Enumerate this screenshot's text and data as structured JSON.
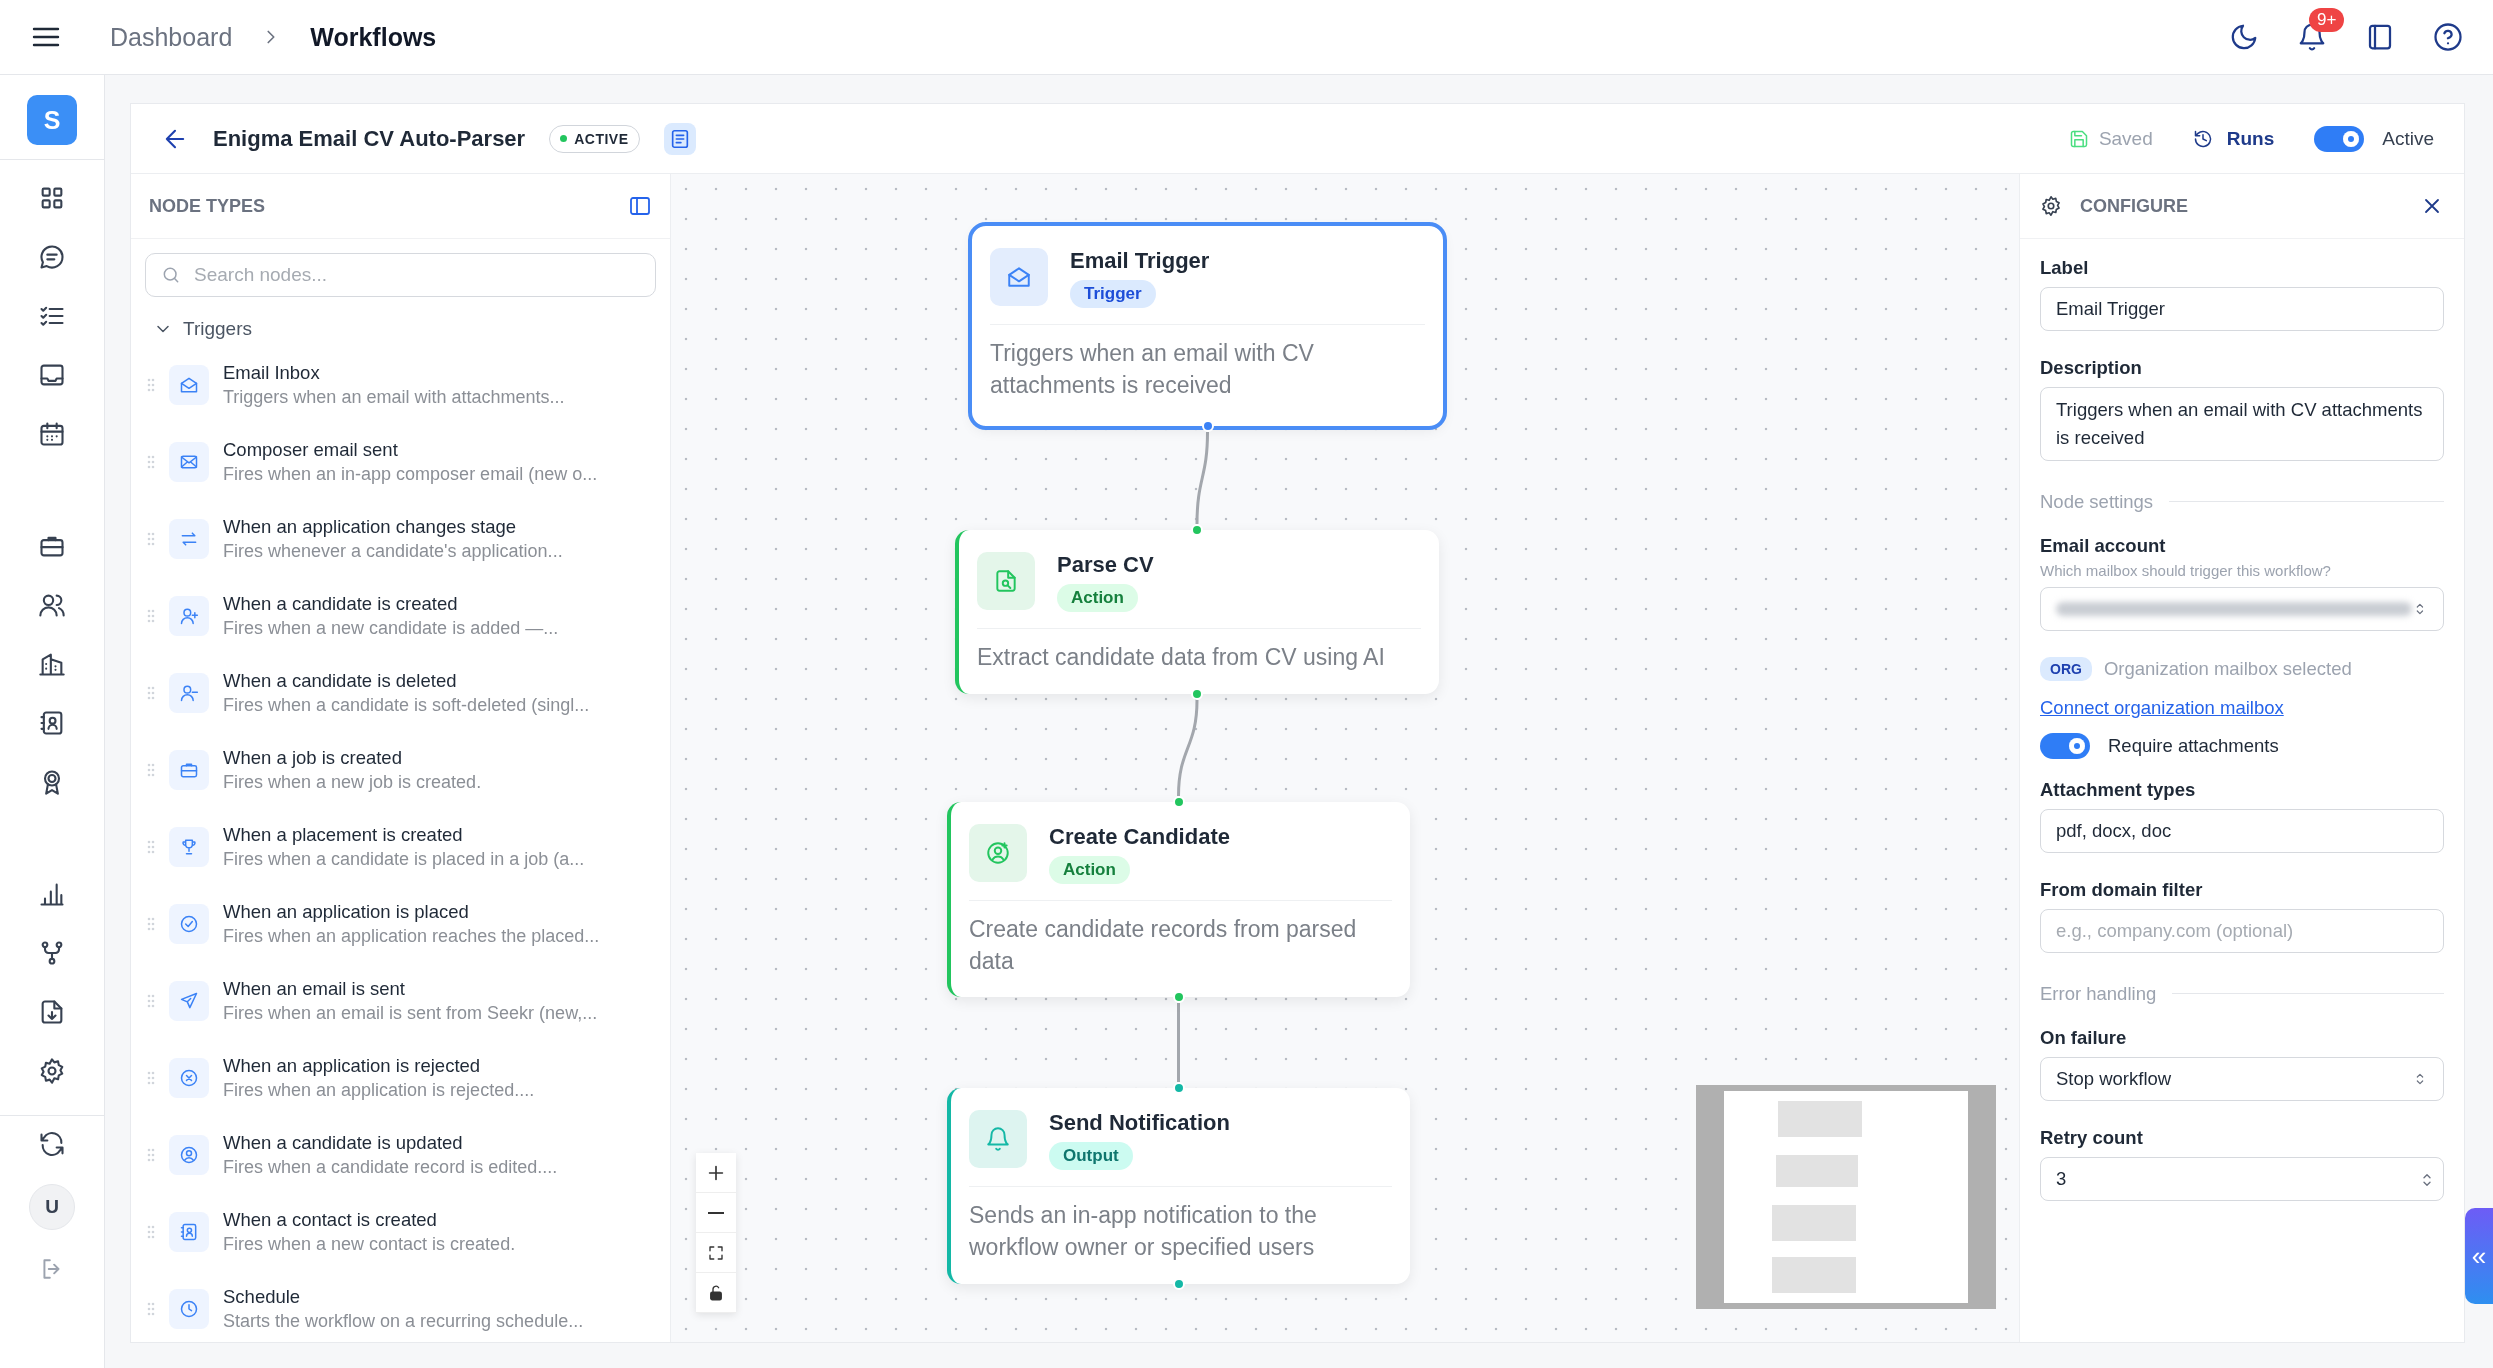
{
  "topbar": {
    "breadcrumb": [
      {
        "label": "Dashboard",
        "selected": false
      },
      {
        "label": "Workflows",
        "selected": true
      }
    ],
    "notification_count": "9+"
  },
  "rail": {
    "logo": "S",
    "avatar": "U"
  },
  "header": {
    "title": "Enigma Email CV Auto-Parser",
    "status": "ACTIVE",
    "saved": "Saved",
    "runs": "Runs",
    "active_toggle": {
      "label": "Active",
      "on": true
    }
  },
  "node_types": {
    "title": "NODE TYPES",
    "search": {
      "placeholder": "Search nodes..."
    },
    "group": {
      "label": "Triggers",
      "expanded": true,
      "items": [
        {
          "title": "Email Inbox",
          "description": "Triggers when an email with attachments..."
        },
        {
          "title": "Composer email sent",
          "description": "Fires when an in-app composer email (new o..."
        },
        {
          "title": "When an application changes stage",
          "description": "Fires whenever a candidate's application..."
        },
        {
          "title": "When a candidate is created",
          "description": "Fires when a new candidate is added —..."
        },
        {
          "title": "When a candidate is deleted",
          "description": "Fires when a candidate is soft-deleted (singl..."
        },
        {
          "title": "When a job is created",
          "description": "Fires when a new job is created."
        },
        {
          "title": "When a placement is created",
          "description": "Fires when a candidate is placed in a job (a..."
        },
        {
          "title": "When an application is placed",
          "description": "Fires when an application reaches the placed..."
        },
        {
          "title": "When an email is sent",
          "description": "Fires when an email is sent from Seekr (new,..."
        },
        {
          "title": "When an application is rejected",
          "description": "Fires when an application is rejected...."
        },
        {
          "title": "When a candidate is updated",
          "description": "Fires when a candidate record is edited...."
        },
        {
          "title": "When a contact is created",
          "description": "Fires when a new contact is created."
        },
        {
          "title": "Schedule",
          "description": "Starts the workflow on a recurring schedule..."
        }
      ]
    }
  },
  "canvas": {
    "nodes": [
      {
        "title": "Email Trigger",
        "badge": "Trigger",
        "kind": "trigger",
        "description": "Triggers when an email with CV attachments is received",
        "selected": true
      },
      {
        "title": "Parse CV",
        "badge": "Action",
        "kind": "action",
        "description": "Extract candidate data from CV using AI",
        "selected": false
      },
      {
        "title": "Create Candidate",
        "badge": "Action",
        "kind": "action",
        "description": "Create candidate records from parsed data",
        "selected": false
      },
      {
        "title": "Send Notification",
        "badge": "Output",
        "kind": "output",
        "description": "Sends an in-app notification to the workflow owner or specified users",
        "selected": false
      }
    ]
  },
  "configure": {
    "title": "CONFIGURE",
    "fields": [
      {
        "kind": "text",
        "label": "Label",
        "value": "Email Trigger"
      },
      {
        "kind": "textarea",
        "label": "Description",
        "value": "Triggers when an email with CV attachments is received"
      },
      {
        "kind": "section",
        "label": "Node settings"
      },
      {
        "kind": "select",
        "label": "Email account",
        "hint": "Which mailbox should trigger this workflow?"
      },
      {
        "kind": "tag",
        "tag": "ORG",
        "label": "Organization mailbox selected"
      },
      {
        "kind": "link",
        "label": "Connect organization mailbox"
      },
      {
        "kind": "toggle",
        "label": "Require attachments",
        "on": true
      },
      {
        "kind": "text",
        "label": "Attachment types",
        "value": "pdf, docx, doc"
      },
      {
        "kind": "text",
        "label": "From domain filter",
        "placeholder": "e.g., company.com (optional)"
      },
      {
        "kind": "section",
        "label": "Error handling"
      },
      {
        "kind": "select",
        "label": "On failure",
        "value": "Stop workflow"
      },
      {
        "kind": "number",
        "label": "Retry count",
        "value": "3"
      }
    ]
  },
  "collapse_button": "«"
}
